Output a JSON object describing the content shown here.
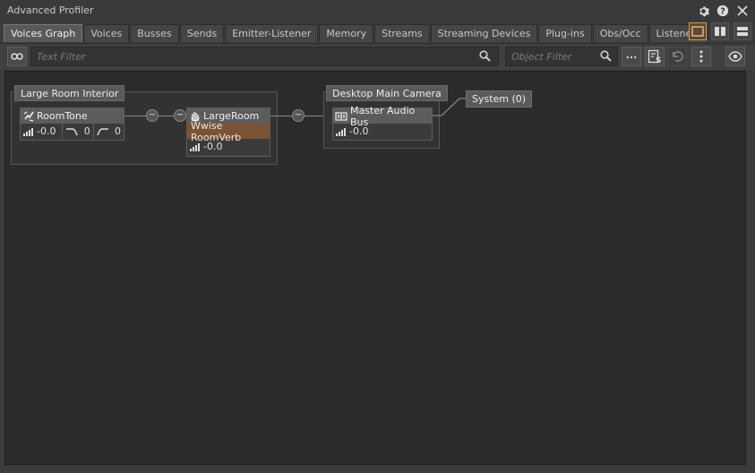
{
  "window": {
    "title": "Advanced Profiler"
  },
  "window_buttons": [
    {
      "name": "settings-icon",
      "glyph": "⚙"
    },
    {
      "name": "help-icon",
      "glyph": "?"
    },
    {
      "name": "close-icon",
      "glyph": "✕"
    }
  ],
  "tabs": [
    "Voices Graph",
    "Voices",
    "Busses",
    "Sends",
    "Emitter-Listener",
    "Memory",
    "Streams",
    "Streaming Devices",
    "Plug-ins",
    "Obs/Occ",
    "Listeners"
  ],
  "active_tab": 0,
  "toolbar": {
    "text_filter_placeholder": "Text Filter",
    "object_filter_placeholder": "Object Filter",
    "more_label": "..."
  },
  "graph": {
    "group1": {
      "label": "Large Room Interior"
    },
    "group2": {
      "label": "Desktop Main Camera"
    },
    "roomtone": {
      "name": "RoomTone",
      "volume": "-0.0",
      "lpf": "0",
      "hpf": "0"
    },
    "largeroom": {
      "name": "LargeRoom",
      "effect": "Wwise RoomVerb",
      "volume": "-0.0"
    },
    "masterbus": {
      "name": "Master Audio Bus",
      "volume": "-0.0"
    },
    "system": {
      "label": "System (0)"
    }
  },
  "colors": {
    "accent": "#d79b47",
    "effect_bg": "#7a5236",
    "canvas_bg": "#2b2b2b"
  }
}
